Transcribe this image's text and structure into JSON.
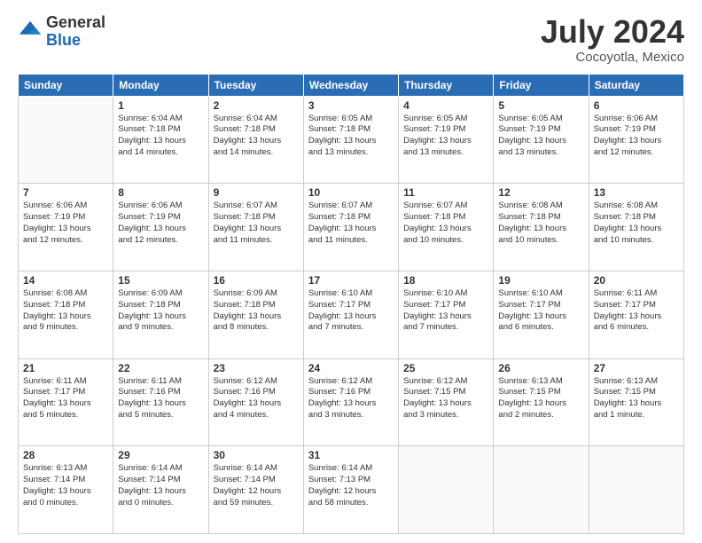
{
  "header": {
    "logo_general": "General",
    "logo_blue": "Blue",
    "title": "July 2024",
    "subtitle": "Cocoyotla, Mexico"
  },
  "calendar": {
    "days_of_week": [
      "Sunday",
      "Monday",
      "Tuesday",
      "Wednesday",
      "Thursday",
      "Friday",
      "Saturday"
    ],
    "weeks": [
      [
        {
          "day": "",
          "info": ""
        },
        {
          "day": "1",
          "info": "Sunrise: 6:04 AM\nSunset: 7:18 PM\nDaylight: 13 hours\nand 14 minutes."
        },
        {
          "day": "2",
          "info": "Sunrise: 6:04 AM\nSunset: 7:18 PM\nDaylight: 13 hours\nand 14 minutes."
        },
        {
          "day": "3",
          "info": "Sunrise: 6:05 AM\nSunset: 7:18 PM\nDaylight: 13 hours\nand 13 minutes."
        },
        {
          "day": "4",
          "info": "Sunrise: 6:05 AM\nSunset: 7:19 PM\nDaylight: 13 hours\nand 13 minutes."
        },
        {
          "day": "5",
          "info": "Sunrise: 6:05 AM\nSunset: 7:19 PM\nDaylight: 13 hours\nand 13 minutes."
        },
        {
          "day": "6",
          "info": "Sunrise: 6:06 AM\nSunset: 7:19 PM\nDaylight: 13 hours\nand 12 minutes."
        }
      ],
      [
        {
          "day": "7",
          "info": "Sunrise: 6:06 AM\nSunset: 7:19 PM\nDaylight: 13 hours\nand 12 minutes."
        },
        {
          "day": "8",
          "info": "Sunrise: 6:06 AM\nSunset: 7:19 PM\nDaylight: 13 hours\nand 12 minutes."
        },
        {
          "day": "9",
          "info": "Sunrise: 6:07 AM\nSunset: 7:18 PM\nDaylight: 13 hours\nand 11 minutes."
        },
        {
          "day": "10",
          "info": "Sunrise: 6:07 AM\nSunset: 7:18 PM\nDaylight: 13 hours\nand 11 minutes."
        },
        {
          "day": "11",
          "info": "Sunrise: 6:07 AM\nSunset: 7:18 PM\nDaylight: 13 hours\nand 10 minutes."
        },
        {
          "day": "12",
          "info": "Sunrise: 6:08 AM\nSunset: 7:18 PM\nDaylight: 13 hours\nand 10 minutes."
        },
        {
          "day": "13",
          "info": "Sunrise: 6:08 AM\nSunset: 7:18 PM\nDaylight: 13 hours\nand 10 minutes."
        }
      ],
      [
        {
          "day": "14",
          "info": "Sunrise: 6:08 AM\nSunset: 7:18 PM\nDaylight: 13 hours\nand 9 minutes."
        },
        {
          "day": "15",
          "info": "Sunrise: 6:09 AM\nSunset: 7:18 PM\nDaylight: 13 hours\nand 9 minutes."
        },
        {
          "day": "16",
          "info": "Sunrise: 6:09 AM\nSunset: 7:18 PM\nDaylight: 13 hours\nand 8 minutes."
        },
        {
          "day": "17",
          "info": "Sunrise: 6:10 AM\nSunset: 7:17 PM\nDaylight: 13 hours\nand 7 minutes."
        },
        {
          "day": "18",
          "info": "Sunrise: 6:10 AM\nSunset: 7:17 PM\nDaylight: 13 hours\nand 7 minutes."
        },
        {
          "day": "19",
          "info": "Sunrise: 6:10 AM\nSunset: 7:17 PM\nDaylight: 13 hours\nand 6 minutes."
        },
        {
          "day": "20",
          "info": "Sunrise: 6:11 AM\nSunset: 7:17 PM\nDaylight: 13 hours\nand 6 minutes."
        }
      ],
      [
        {
          "day": "21",
          "info": "Sunrise: 6:11 AM\nSunset: 7:17 PM\nDaylight: 13 hours\nand 5 minutes."
        },
        {
          "day": "22",
          "info": "Sunrise: 6:11 AM\nSunset: 7:16 PM\nDaylight: 13 hours\nand 5 minutes."
        },
        {
          "day": "23",
          "info": "Sunrise: 6:12 AM\nSunset: 7:16 PM\nDaylight: 13 hours\nand 4 minutes."
        },
        {
          "day": "24",
          "info": "Sunrise: 6:12 AM\nSunset: 7:16 PM\nDaylight: 13 hours\nand 3 minutes."
        },
        {
          "day": "25",
          "info": "Sunrise: 6:12 AM\nSunset: 7:15 PM\nDaylight: 13 hours\nand 3 minutes."
        },
        {
          "day": "26",
          "info": "Sunrise: 6:13 AM\nSunset: 7:15 PM\nDaylight: 13 hours\nand 2 minutes."
        },
        {
          "day": "27",
          "info": "Sunrise: 6:13 AM\nSunset: 7:15 PM\nDaylight: 13 hours\nand 1 minute."
        }
      ],
      [
        {
          "day": "28",
          "info": "Sunrise: 6:13 AM\nSunset: 7:14 PM\nDaylight: 13 hours\nand 0 minutes."
        },
        {
          "day": "29",
          "info": "Sunrise: 6:14 AM\nSunset: 7:14 PM\nDaylight: 13 hours\nand 0 minutes."
        },
        {
          "day": "30",
          "info": "Sunrise: 6:14 AM\nSunset: 7:14 PM\nDaylight: 12 hours\nand 59 minutes."
        },
        {
          "day": "31",
          "info": "Sunrise: 6:14 AM\nSunset: 7:13 PM\nDaylight: 12 hours\nand 58 minutes."
        },
        {
          "day": "",
          "info": ""
        },
        {
          "day": "",
          "info": ""
        },
        {
          "day": "",
          "info": ""
        }
      ]
    ]
  }
}
